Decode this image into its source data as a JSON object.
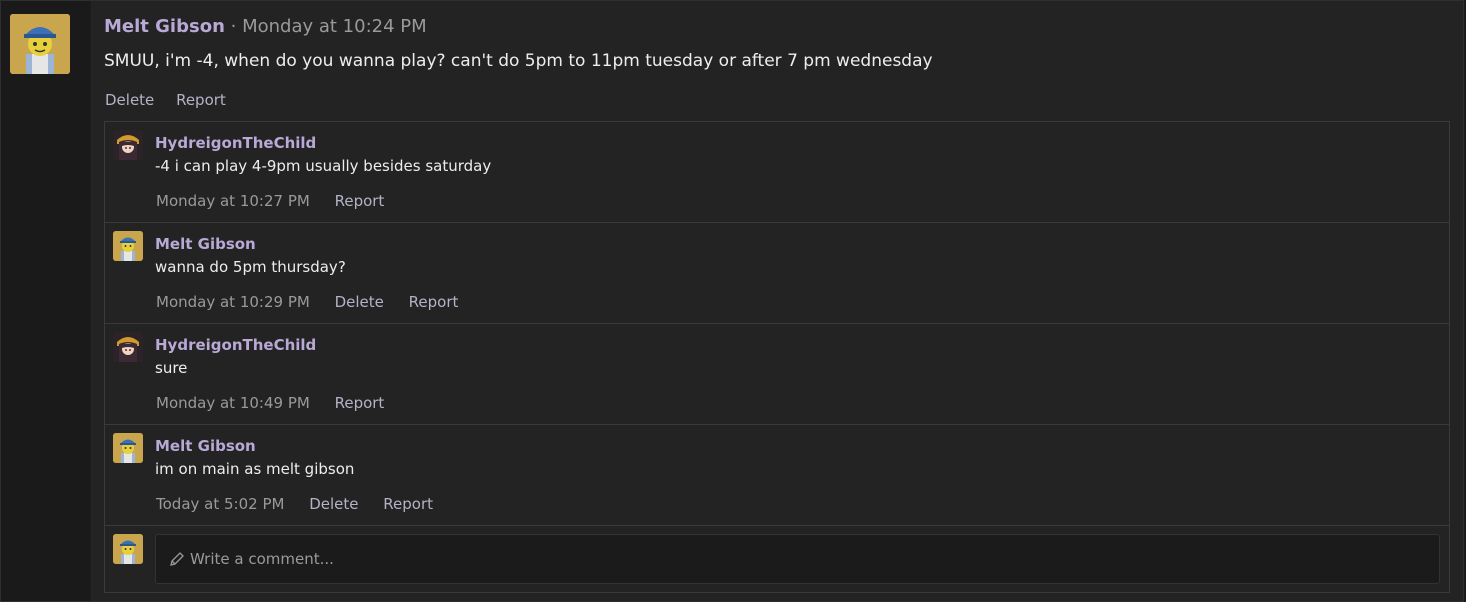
{
  "post": {
    "author": "Melt Gibson",
    "separator": "·",
    "time": "Monday at 10:24 PM",
    "body": "SMUU, i'm -4, when do you wanna play? can't do 5pm to 11pm tuesday or after 7 pm wednesday",
    "actions": [
      "Delete",
      "Report"
    ]
  },
  "comments": [
    {
      "author": "HydreigonTheChild",
      "avatar": "anime-avatar",
      "text": "-4 i can play 4-9pm usually besides saturday",
      "time": "Monday at 10:27 PM",
      "actions": [
        "Report"
      ]
    },
    {
      "author": "Melt Gibson",
      "avatar": "mechanic-avatar",
      "text": "wanna do 5pm thursday?",
      "time": "Monday at 10:29 PM",
      "actions": [
        "Delete",
        "Report"
      ]
    },
    {
      "author": "HydreigonTheChild",
      "avatar": "anime-avatar",
      "text": "sure",
      "time": "Monday at 10:49 PM",
      "actions": [
        "Report"
      ]
    },
    {
      "author": "Melt Gibson",
      "avatar": "mechanic-avatar",
      "text": "im on main as melt gibson",
      "time": "Today at 5:02 PM",
      "actions": [
        "Delete",
        "Report"
      ]
    }
  ],
  "composer": {
    "placeholder": "Write a comment...",
    "icon": "pencil-icon"
  },
  "colors": {
    "username": "#b9a9d6",
    "link": "#b3b3c8",
    "muted": "#9a9a9a",
    "background": "#232323"
  }
}
